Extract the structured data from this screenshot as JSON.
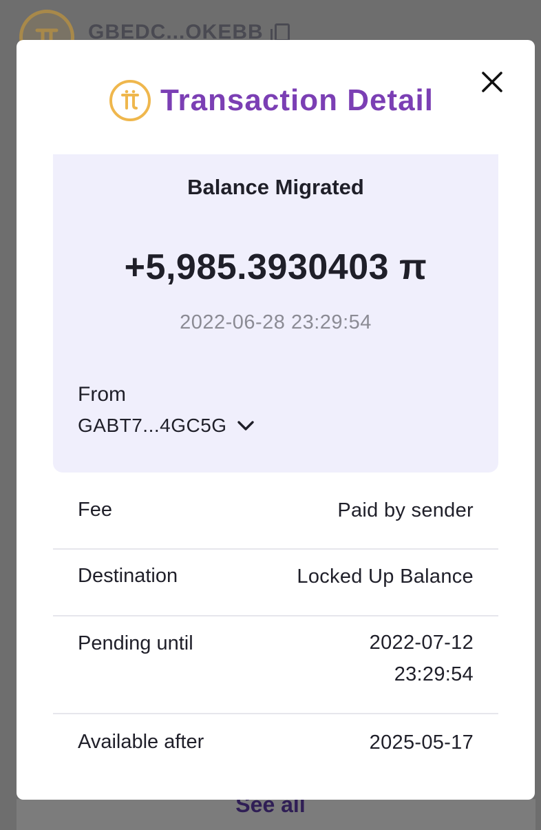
{
  "background": {
    "address_partial": "GBEDC...OKEBB",
    "see_all_label": "See all"
  },
  "modal": {
    "title": "Transaction Detail",
    "close_icon": "close-icon",
    "summary": {
      "type": "Balance Migrated",
      "amount": "+5,985.3930403 π",
      "date": "2022-06-28 23:29:54",
      "from_label": "From",
      "from_address": "GABT7...4GC5G"
    },
    "details": [
      {
        "label": "Fee",
        "value": "Paid by sender"
      },
      {
        "label": "Destination",
        "value": "Locked Up Balance"
      },
      {
        "label": "Pending until",
        "value_line1": "2022-07-12",
        "value_line2": "23:29:54"
      },
      {
        "label": "Available after",
        "value": "2025-05-17"
      }
    ]
  },
  "colors": {
    "title": "#7b3fb4",
    "pi_gold": "#efb74d",
    "summary_bg": "#f0effc",
    "overlay": "#6e6e6e"
  }
}
